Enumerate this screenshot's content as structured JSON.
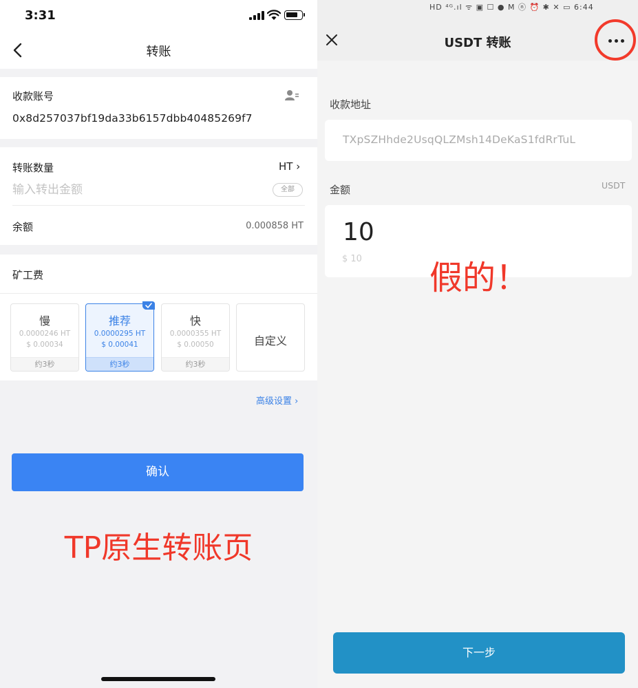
{
  "left": {
    "status_time": "3:31",
    "nav_title": "转账",
    "recipient": {
      "label": "收款账号",
      "address": "0x8d257037bf19da33b6157dbb40485269f7"
    },
    "amount": {
      "label": "转账数量",
      "coin": "HT ›",
      "placeholder": "输入转出金额",
      "all_label": "全部",
      "balance_label": "余额",
      "balance_value": "0.000858 HT"
    },
    "fee": {
      "title": "矿工费",
      "options": [
        {
          "name": "慢",
          "amount": "0.0000246 HT",
          "usd": "$ 0.00034",
          "eta": "约3秒"
        },
        {
          "name": "推荐",
          "amount": "0.0000295 HT",
          "usd": "$ 0.00041",
          "eta": "约3秒"
        },
        {
          "name": "快",
          "amount": "0.0000355 HT",
          "usd": "$ 0.00050",
          "eta": "约3秒"
        },
        {
          "name": "自定义"
        }
      ],
      "selected_index": 1
    },
    "advanced_label": "高级设置 ›",
    "confirm_label": "确认",
    "caption": "TP原生转账页"
  },
  "right": {
    "status_text": "HD ⁴ᴳ.ıl ᯤ ▣ ☐ ● M  ⓝ ⏰ ✱ ✕ ▭ 6:44",
    "title": "USDT 转账",
    "recipient_label": "收款地址",
    "recipient_address": "TXpSZHhde2UsqQLZMsh14DeKaS1fdRrTuL",
    "amount_label": "金额",
    "currency": "USDT",
    "amount_value": "10",
    "amount_usd": "$ 10",
    "caption": "假的！",
    "next_label": "下一步"
  },
  "colors": {
    "accent_blue": "#3a84f3",
    "next_button": "#2291c6",
    "annotation_red": "#f0382a"
  },
  "icons": [
    "back-arrow-icon",
    "contact-book-icon",
    "close-icon",
    "more-dots-icon",
    "check-icon",
    "signal-icon",
    "wifi-icon",
    "battery-icon"
  ]
}
